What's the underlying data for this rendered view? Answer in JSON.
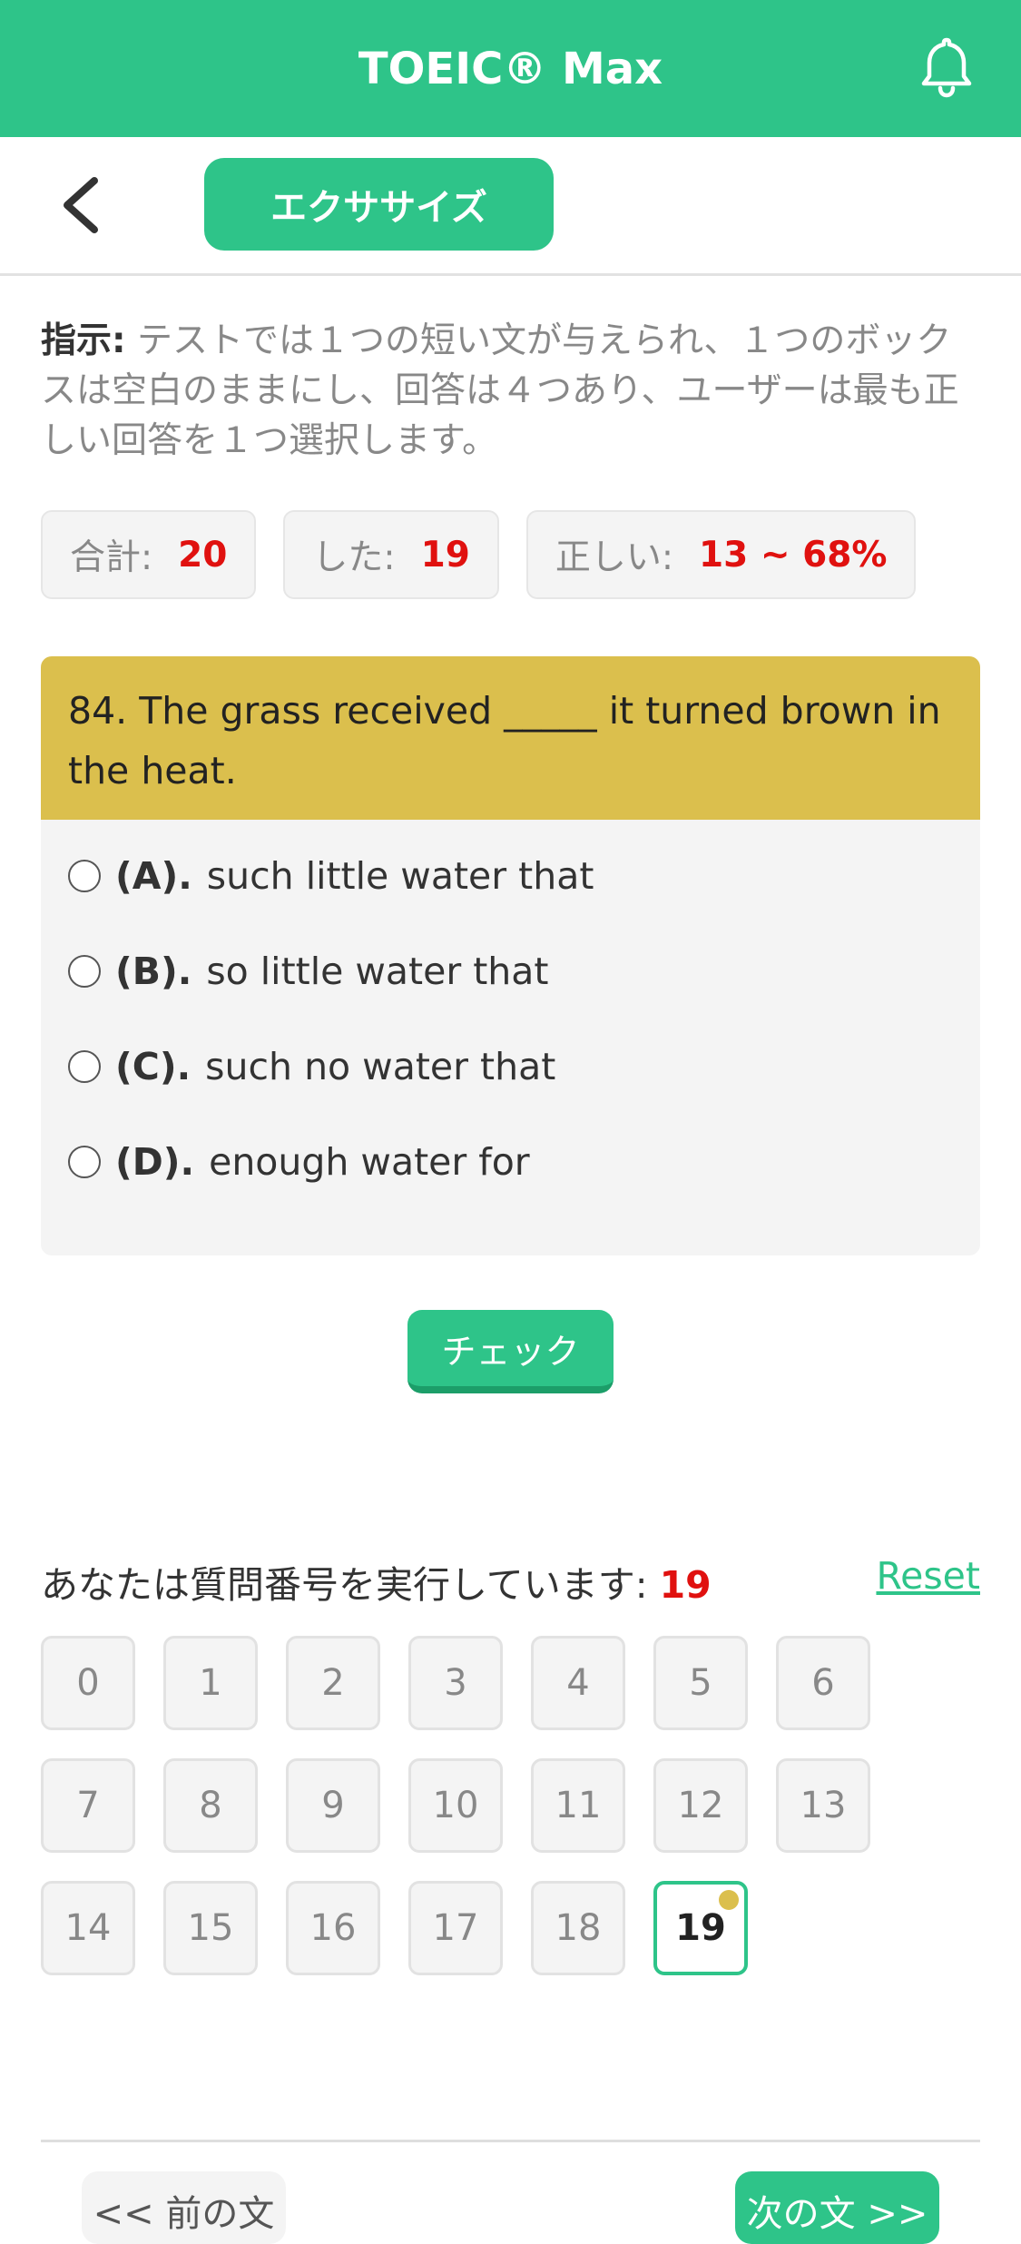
{
  "app": {
    "title": "TOEIC® Max"
  },
  "nav": {
    "tab_label": "エクササイズ"
  },
  "instructions": {
    "label": "指示:",
    "text": " テストでは１つの短い文が与えられ、１つのボックスは空白のままにし、回答は４つあり、ユーザーは最も正しい回答を１つ選択します。"
  },
  "stats": {
    "total_label": "合計:",
    "total_value": "20",
    "done_label": "した:",
    "done_value": "19",
    "correct_label": "正しい:",
    "correct_value": "13 ~ 68%"
  },
  "question": {
    "text": "84. The grass received _____ it turned brown in the heat.",
    "options": [
      {
        "letter": "(A).",
        "text": "such little water that"
      },
      {
        "letter": "(B).",
        "text": "so little water that"
      },
      {
        "letter": "(C).",
        "text": "such no water that"
      },
      {
        "letter": "(D).",
        "text": "enough water for"
      }
    ]
  },
  "check_label": "チェック",
  "progress": {
    "label": "あなたは質問番号を実行しています:",
    "current": "19",
    "reset_label": "Reset"
  },
  "question_numbers": [
    "0",
    "1",
    "2",
    "3",
    "4",
    "5",
    "6",
    "7",
    "8",
    "9",
    "10",
    "11",
    "12",
    "13",
    "14",
    "15",
    "16",
    "17",
    "18",
    "19"
  ],
  "current_index": 19,
  "footer": {
    "prev_label": "<< 前の文",
    "next_label": "次の文 >>"
  },
  "colors": {
    "primary": "#2ec489",
    "question_header": "#dbbf4d",
    "highlight": "#e0110f"
  },
  "icons": {
    "bell": "bell-icon",
    "back": "chevron-left-icon"
  }
}
